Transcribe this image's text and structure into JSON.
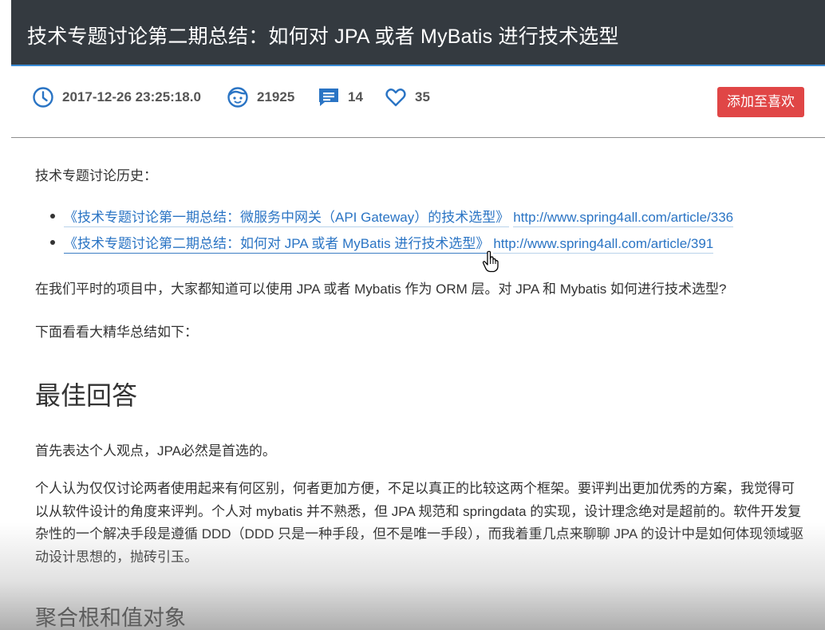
{
  "title": "技术专题讨论第二期总结：如何对 JPA 或者 MyBatis 进行技术选型",
  "meta": {
    "date": "2017-12-26 23:25:18.0",
    "views": "21925",
    "comments": "14",
    "likes": "35",
    "like_button": "添加至喜欢",
    "colors": {
      "header_bg": "#343a40",
      "accent": "#3a8bd6",
      "like_button": "#e04646",
      "link": "#2a74c4"
    }
  },
  "article": {
    "history_label": "技术专题讨论历史：",
    "history": [
      {
        "title": "《技术专题讨论第一期总结：微服务中网关（API Gateway）的技术选型》",
        "url": "http://www.spring4all.com/article/336"
      },
      {
        "title": "《技术专题讨论第二期总结：如何对 JPA 或者 MyBatis 进行技术选型》",
        "url": "http://www.spring4all.com/article/391"
      }
    ],
    "intro": "在我们平时的项目中，大家都知道可以使用 JPA 或者 Mybatis 作为 ORM 层。对 JPA 和 Mybatis 如何进行技术选型?",
    "summary_lead": "下面看看大精华总结如下：",
    "best_answer_heading": "最佳回答",
    "opinion": "首先表达个人观点，JPA必然是首选的。",
    "body": "个人认为仅仅讨论两者使用起来有何区别，何者更加方便，不足以真正的比较这两个框架。要评判出更加优秀的方案，我觉得可以从软件设计的角度来评判。个人对 mybatis 并不熟悉，但 JPA 规范和 springdata 的实现，设计理念绝对是超前的。软件开发复杂性的一个解决手段是遵循 DDD（DDD 只是一种手段，但不是唯一手段），而我着重几点来聊聊 JPA 的设计中是如何体现领域驱动设计思想的，抛砖引玉。",
    "aggregate_heading": "聚合根和值对象"
  }
}
